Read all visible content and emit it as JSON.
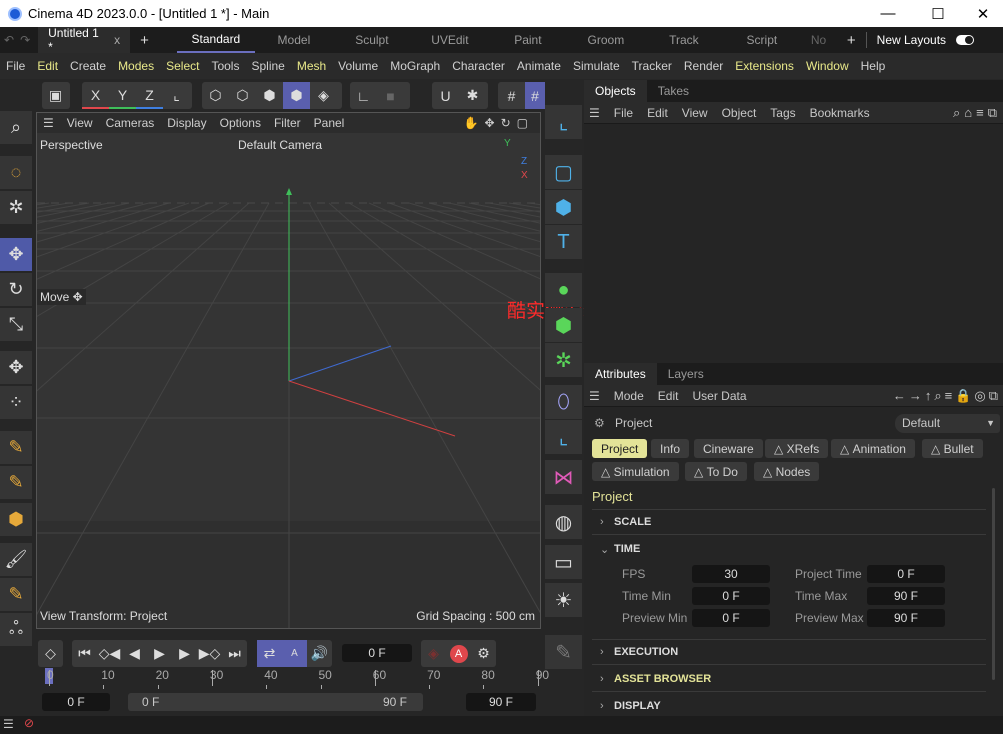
{
  "window": {
    "title": "Cinema 4D 2023.0.0 - [Untitled 1 *] - Main",
    "minimize": "—",
    "maximize": "☐",
    "close": "✕"
  },
  "doc_tabs": {
    "undo": "↶",
    "redo": "↷",
    "document": "Untitled 1 *",
    "close": "x",
    "add": "+"
  },
  "layouts": [
    "Standard",
    "Model",
    "Sculpt",
    "UVEdit",
    "Paint",
    "Groom",
    "Track",
    "Script",
    "No"
  ],
  "layout_add": "+",
  "new_layouts": "New Layouts",
  "menu": [
    {
      "label": "File",
      "hl": false
    },
    {
      "label": "Edit",
      "hl": true
    },
    {
      "label": "Create",
      "hl": false
    },
    {
      "label": "Modes",
      "hl": true
    },
    {
      "label": "Select",
      "hl": true
    },
    {
      "label": "Tools",
      "hl": false
    },
    {
      "label": "Spline",
      "hl": false
    },
    {
      "label": "Mesh",
      "hl": true
    },
    {
      "label": "Volume",
      "hl": false
    },
    {
      "label": "MoGraph",
      "hl": false
    },
    {
      "label": "Character",
      "hl": false
    },
    {
      "label": "Animate",
      "hl": false
    },
    {
      "label": "Simulate",
      "hl": false
    },
    {
      "label": "Tracker",
      "hl": false
    },
    {
      "label": "Render",
      "hl": false
    },
    {
      "label": "Extensions",
      "hl": true
    },
    {
      "label": "Window",
      "hl": true
    },
    {
      "label": "Help",
      "hl": false
    }
  ],
  "axis_buttons": {
    "x": "X",
    "y": "Y",
    "z": "Z"
  },
  "viewport": {
    "menu": [
      "View",
      "Cameras",
      "Display",
      "Options",
      "Filter",
      "Panel"
    ],
    "name": "Perspective",
    "camera": "Default Camera",
    "tool_label": "Move",
    "view_transform": "View Transform: Project",
    "grid_spacing": "Grid Spacing : 500 cm",
    "axis_y": "Y",
    "axis_z": "Z",
    "axis_x": "X"
  },
  "overlay_text": "酷实测安装成功",
  "objects": {
    "tabs": [
      "Objects",
      "Takes"
    ],
    "menu": [
      "File",
      "Edit",
      "View",
      "Object",
      "Tags",
      "Bookmarks"
    ]
  },
  "attributes": {
    "tabs": [
      "Attributes",
      "Layers"
    ],
    "menu": [
      "Mode",
      "Edit",
      "User Data"
    ],
    "object": "Project",
    "preset": "Default",
    "chips": [
      "Project",
      "Info",
      "Cineware",
      "XRefs",
      "Animation",
      "Bullet",
      "Simulation",
      "To Do",
      "Nodes"
    ],
    "heading": "Project",
    "sections": [
      "SCALE",
      "TIME",
      "EXECUTION",
      "ASSET BROWSER",
      "DISPLAY"
    ],
    "fields": {
      "fps_label": "FPS",
      "fps": "30",
      "project_time_label": "Project Time",
      "project_time": "0 F",
      "time_min_label": "Time Min",
      "time_min": "0 F",
      "time_max_label": "Time Max",
      "time_max": "90 F",
      "preview_min_label": "Preview Min",
      "preview_min": "0 F",
      "preview_max_label": "Preview Max",
      "preview_max": "90 F"
    }
  },
  "timeline": {
    "current_frame": "0 F",
    "ticks": [
      "0",
      "10",
      "20",
      "30",
      "40",
      "50",
      "60",
      "70",
      "80",
      "90"
    ],
    "start": "0 F",
    "range_start": "0 F",
    "range_end": "90 F",
    "end": "90 F",
    "autokey": "A"
  },
  "colors": {
    "accent": "#5a5fae",
    "highlight_menu": "#e9e98a",
    "x_axis": "#e0474c",
    "y_axis": "#3fbf5a",
    "z_axis": "#3f7fe0"
  }
}
